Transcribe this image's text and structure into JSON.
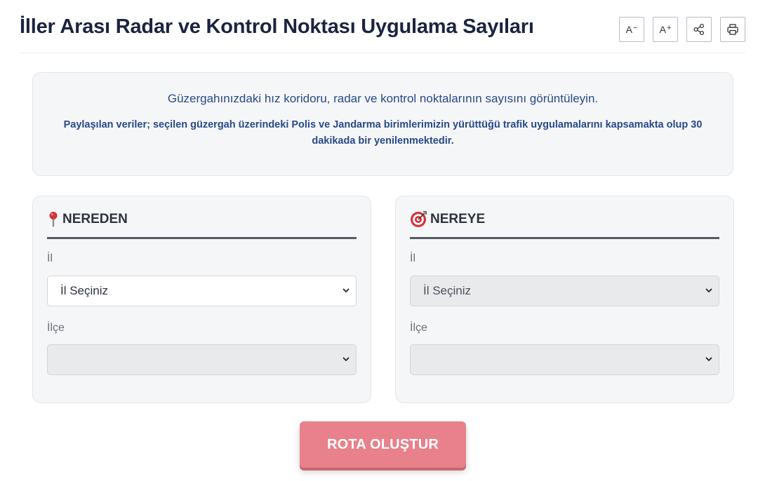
{
  "header": {
    "title": "İller Arası Radar ve Kontrol Noktası Uygulama Sayıları",
    "tools": {
      "font_decrease": "A",
      "font_decrease_mark": "−",
      "font_increase": "A",
      "font_increase_mark": "+",
      "share_icon": "share-icon",
      "print_icon": "printer-icon"
    }
  },
  "info": {
    "main": "Güzergahınızdaki hız koridoru, radar ve kontrol noktalarının sayısını görüntüleyin.",
    "sub": "Paylaşılan veriler; seçilen güzergah üzerindeki Polis ve Jandarma birimlerimizin yürüttüğü trafik uygulamalarını kapsamakta olup 30 dakikada bir yenilenmektedir."
  },
  "from": {
    "title": "NEREDEN",
    "icon": "pin-icon",
    "il_label": "İl",
    "il_value": "İl Seçiniz",
    "ilce_label": "İlçe",
    "ilce_value": ""
  },
  "to": {
    "title": "NEREYE",
    "icon": "target-icon",
    "il_label": "İl",
    "il_value": "İl Seçiniz",
    "ilce_label": "İlçe",
    "ilce_value": ""
  },
  "submit_label": "ROTA OLUŞTUR",
  "colors": {
    "title": "#1b2340",
    "info_text": "#274a8a",
    "button": "#e8818b",
    "panel_bg": "#f5f6f8"
  }
}
